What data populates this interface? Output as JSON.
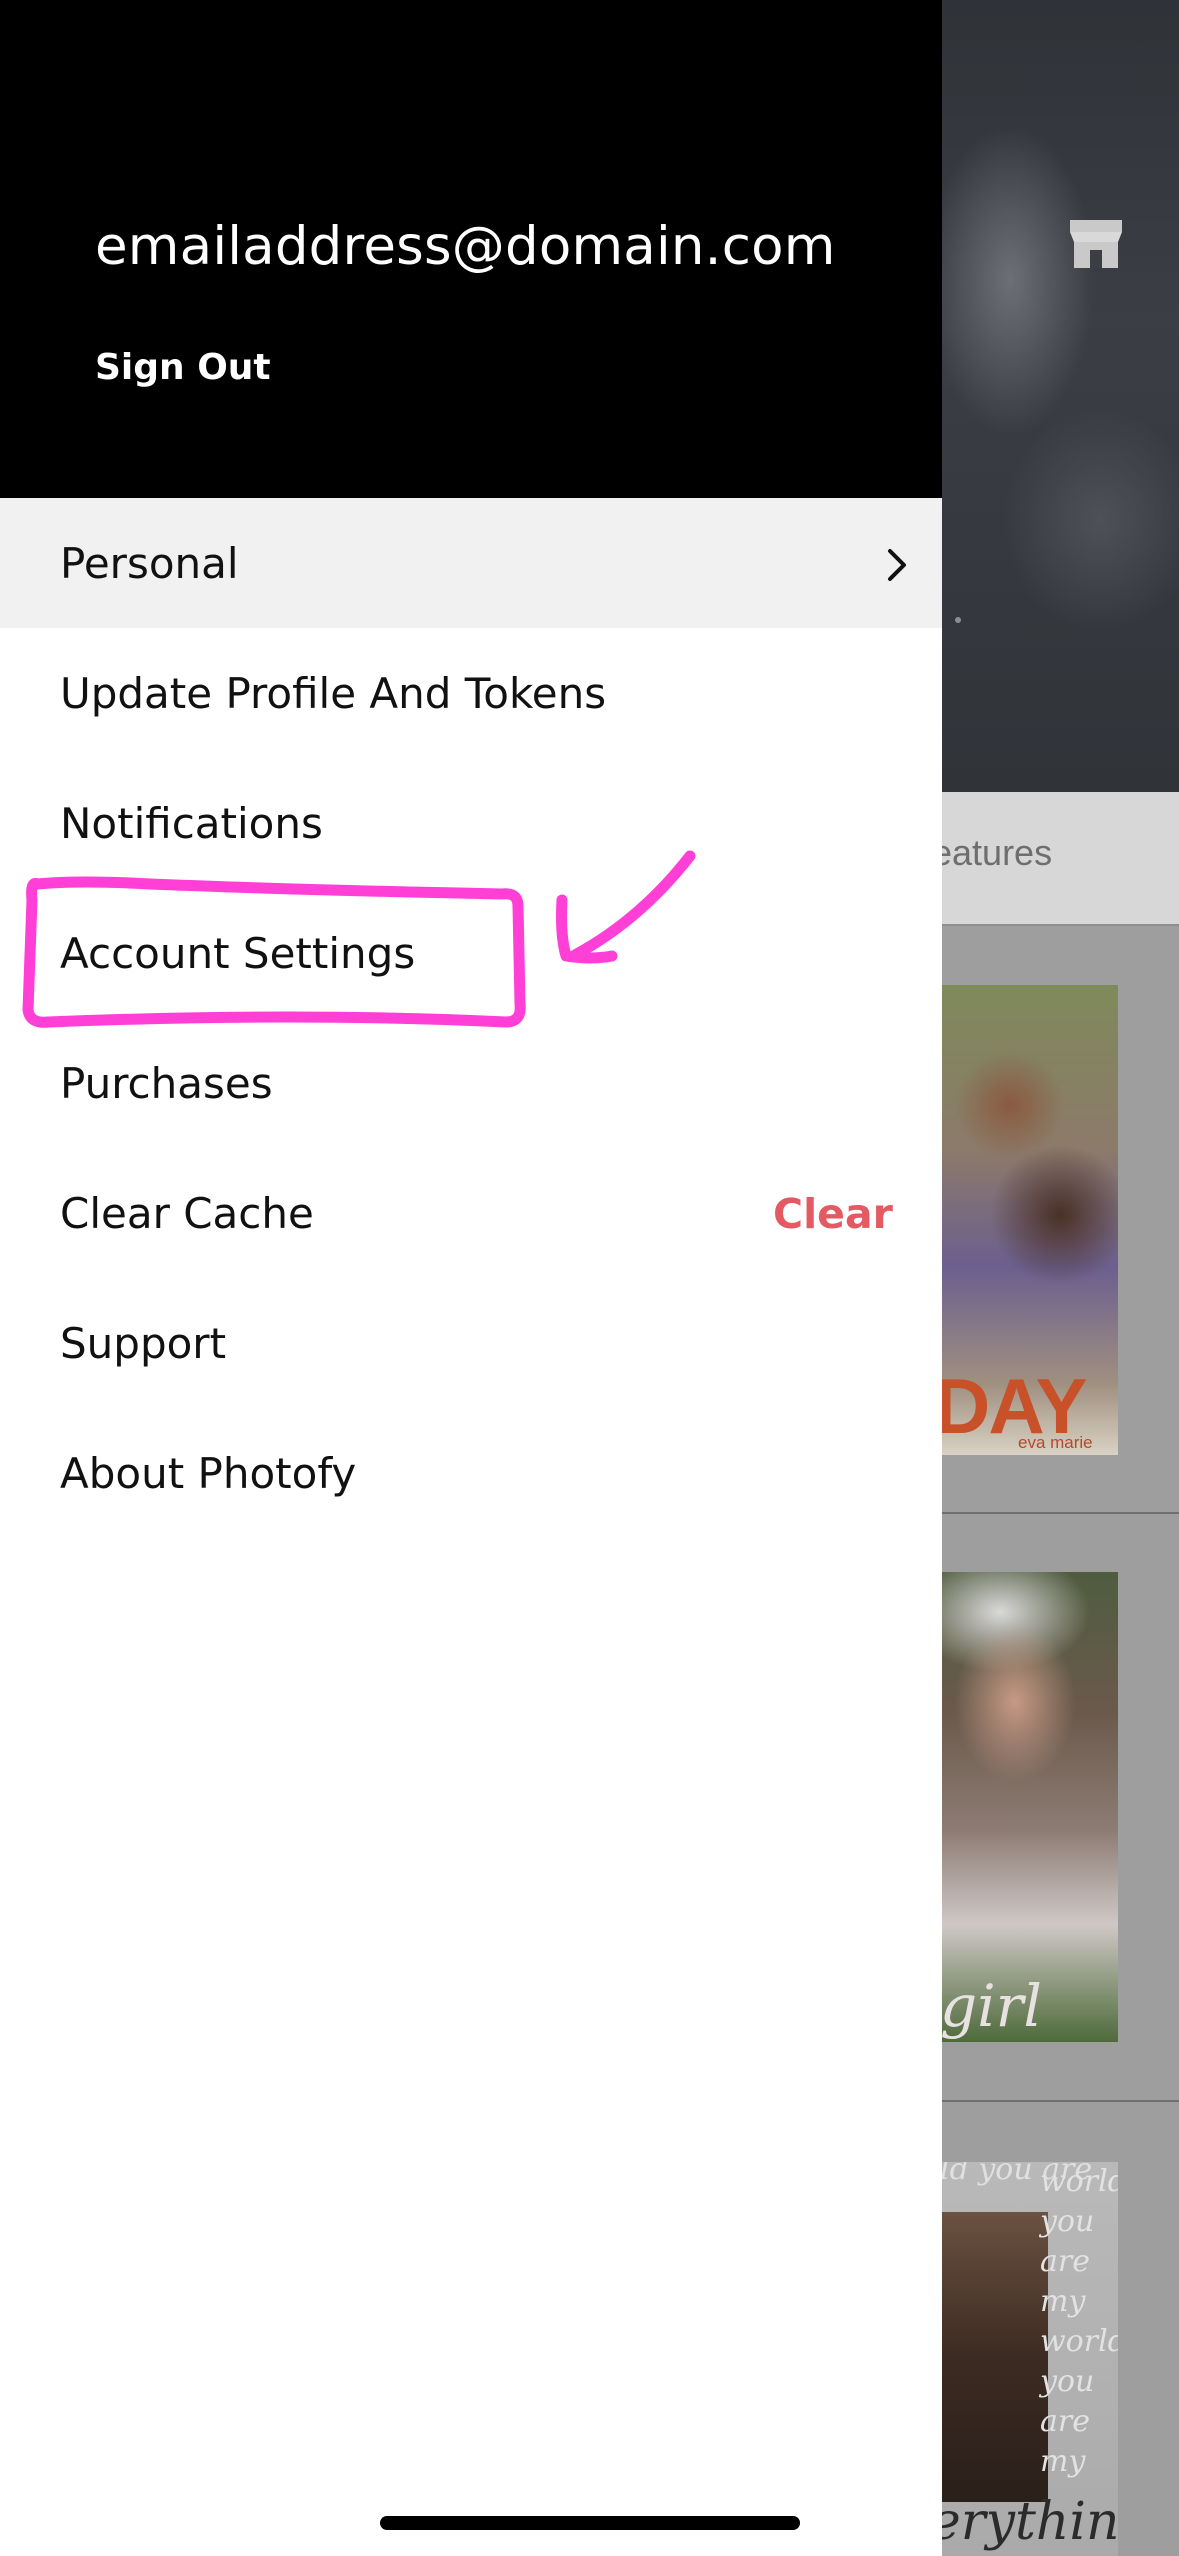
{
  "account": {
    "email": "emailaddress@domain.com",
    "sign_out_label": "Sign Out"
  },
  "menu": {
    "personal": "Personal",
    "update_profile": "Update Profile And Tokens",
    "notifications": "Notifications",
    "account_settings": "Account Settings",
    "purchases": "Purchases",
    "clear_cache": "Clear Cache",
    "clear_action": "Clear",
    "support": "Support",
    "about": "About Photofy"
  },
  "background": {
    "tab_partial": "eatures",
    "card1_text": "DAY",
    "card1_small": "eva marie",
    "card2_text": "girl",
    "card3_top": "ld you are",
    "card3_words": "world you are my world you are my",
    "card3_bottom": "erything"
  },
  "colors": {
    "drawer_header": "#000000",
    "selected_row": "#f1f1f1",
    "clear_accent": "#e35a62",
    "annotation": "#ff3fd6"
  },
  "icons": [
    "store-icon",
    "chevron-right-icon",
    "annotation-arrow-icon"
  ]
}
